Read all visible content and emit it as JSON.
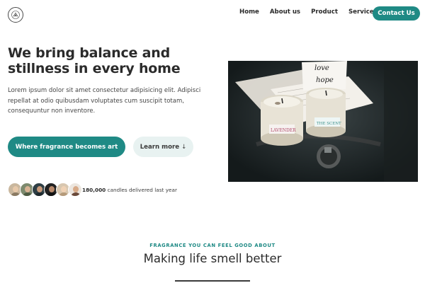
{
  "nav": {
    "items": [
      {
        "label": "Home"
      },
      {
        "label": "About us"
      },
      {
        "label": "Product"
      },
      {
        "label": "Services"
      }
    ],
    "contact_label": "Contact Us"
  },
  "hero": {
    "title": "We bring balance and stillness in every home",
    "body": "Lorem ipsum dolor sit amet consectetur adipisicing elit. Adipisci repellat at odio quibusdam voluptates cum suscipit totam, consequuntur non inventore.",
    "primary_cta": "Where fragrance becomes art",
    "secondary_cta": "Learn more",
    "secondary_cta_arrow": "↓",
    "delivered_count": "180,000",
    "delivered_text": "candles delivered last year",
    "image_labels": {
      "book_line1": "love",
      "book_line2": "hope",
      "jar_left": "LAVENDER",
      "jar_right": "THE SCENT"
    }
  },
  "section": {
    "eyebrow": "FRAGRANCE YOU CAN FEEL GOOD ABOUT",
    "title": "Making life smell better"
  },
  "colors": {
    "accent": "#1f8a85",
    "secondary_bg": "#e8f2f1",
    "text": "#2b2b2b"
  },
  "icons": {
    "logo": "round-emblem-logo"
  }
}
